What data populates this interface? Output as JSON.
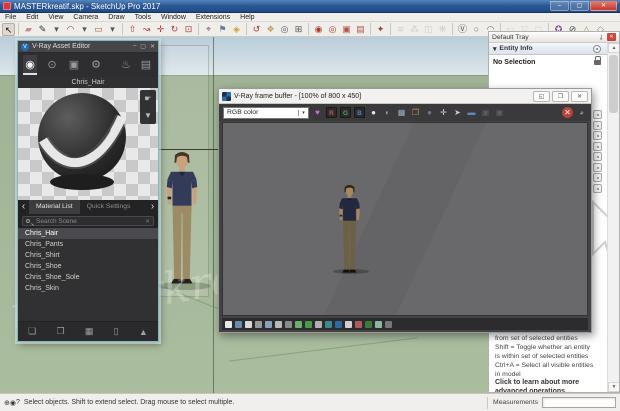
{
  "window": {
    "title": "MASTERkreatif.skp - SketchUp Pro 2017",
    "controls": [
      {
        "name": "minimize-button",
        "glyph": "–"
      },
      {
        "name": "maximize-button",
        "glyph": "▢"
      },
      {
        "name": "close-button",
        "glyph": "✕"
      }
    ]
  },
  "menu": {
    "items": [
      "File",
      "Edit",
      "View",
      "Camera",
      "Draw",
      "Tools",
      "Window",
      "Extensions",
      "Help"
    ]
  },
  "toolbar": {
    "icons": [
      {
        "n": "select-tool",
        "g": "↖",
        "c": "#111",
        "sel": true
      },
      {
        "sep": true
      },
      {
        "n": "eraser-tool",
        "g": "▰",
        "c": "#c98b90"
      },
      {
        "n": "line-tool",
        "g": "✎",
        "c": "#333"
      },
      {
        "n": "line-dropdown",
        "g": "▾",
        "c": "#555"
      },
      {
        "n": "arc-tool",
        "g": "◠",
        "c": "#8a4030"
      },
      {
        "n": "arc-dropdown",
        "g": "▾",
        "c": "#555"
      },
      {
        "n": "rectangle-tool",
        "g": "▭",
        "c": "#9a5a48"
      },
      {
        "n": "shape-dropdown",
        "g": "▾",
        "c": "#555"
      },
      {
        "sep": true
      },
      {
        "n": "push-pull-tool",
        "g": "⇧",
        "c": "#b03a2e"
      },
      {
        "n": "follow-me-tool",
        "g": "↝",
        "c": "#b03a2e"
      },
      {
        "n": "move-tool",
        "g": "✛",
        "c": "#c0392b"
      },
      {
        "n": "rotate-tool",
        "g": "↻",
        "c": "#c0392b"
      },
      {
        "n": "offset-tool",
        "g": "⊡",
        "c": "#b03a2e"
      },
      {
        "sep": true
      },
      {
        "n": "tape-measure-tool",
        "g": "⌖",
        "c": "#a04a6a"
      },
      {
        "n": "dimension-tool",
        "g": "⚑",
        "c": "#667a8a"
      },
      {
        "n": "paint-bucket-tool",
        "g": "◈",
        "c": "#c8a23a"
      },
      {
        "sep": true
      },
      {
        "n": "orbit-tool",
        "g": "↺",
        "c": "#b03a2e"
      },
      {
        "n": "pan-tool",
        "g": "❖",
        "c": "#c49a5a"
      },
      {
        "n": "zoom-tool",
        "g": "◎",
        "c": "#555"
      },
      {
        "n": "zoom-extents-tool",
        "g": "⊞",
        "c": "#555"
      },
      {
        "sep": true
      },
      {
        "n": "vray-render-button",
        "g": "◉",
        "c": "#b03a2e"
      },
      {
        "n": "vray-interactive-render-button",
        "g": "◎",
        "c": "#b03a2e"
      },
      {
        "n": "vray-viewport-render-button",
        "g": "▣",
        "c": "#b5524a"
      },
      {
        "n": "vray-batch-render-button",
        "g": "▤",
        "c": "#b5524a"
      },
      {
        "sep": true
      },
      {
        "n": "vray-asset-editor-button",
        "g": "✦",
        "c": "#b03a2e"
      },
      {
        "sep": true
      },
      {
        "n": "vray-infinite-plane-button",
        "g": "≋",
        "c": "#b9b9b9",
        "d": true
      },
      {
        "n": "vray-fur-button",
        "g": "⁂",
        "c": "#b9b9b9",
        "d": true
      },
      {
        "n": "vray-clipper-button",
        "g": "◫",
        "c": "#b9b9b9",
        "d": true
      },
      {
        "n": "vray-mesh-light-button",
        "g": "❋",
        "c": "#b9b9b9",
        "d": true
      },
      {
        "sep": true
      },
      {
        "n": "vray-logo-button",
        "g": "Ⓥ",
        "c": "#555"
      },
      {
        "n": "vray-sphere-light-button",
        "g": "○",
        "c": "#666"
      },
      {
        "n": "vray-dome-light-button",
        "g": "◠",
        "c": "#666"
      },
      {
        "sep": true
      },
      {
        "n": "vray-rect-light-button",
        "g": "▭",
        "c": "#bbb",
        "d": true
      },
      {
        "n": "vray-spot-light-button",
        "g": "▽",
        "c": "#bbb",
        "d": true
      },
      {
        "n": "vray-ies-light-button",
        "g": "◻",
        "c": "#bbb",
        "d": true
      },
      {
        "sep": true
      },
      {
        "n": "extension-a-button",
        "g": "✪",
        "c": "#7a4a9a"
      },
      {
        "n": "extension-b-button",
        "g": "⊘",
        "c": "#444"
      },
      {
        "n": "extension-c-button",
        "g": "△",
        "c": "#b08a3a"
      },
      {
        "n": "extension-d-button",
        "g": "◇",
        "c": "#888"
      }
    ]
  },
  "viewport": {
    "watermark": "masterkreatif"
  },
  "asset_editor": {
    "title": "V-Ray Asset Editor",
    "logo_glyph": "V",
    "window_controls": [
      {
        "name": "ae-minimize-button",
        "glyph": "–"
      },
      {
        "name": "ae-maximize-button",
        "glyph": "▢"
      },
      {
        "name": "ae-close-button",
        "glyph": "✕"
      }
    ],
    "nav_icons": [
      {
        "n": "materials-tab",
        "g": "◉",
        "sel": true
      },
      {
        "n": "lights-tab",
        "g": "⊙"
      },
      {
        "n": "geometry-tab",
        "g": "▣"
      },
      {
        "n": "settings-tab",
        "g": "⚙"
      }
    ],
    "right_icons": [
      {
        "n": "render-button",
        "g": "♨"
      },
      {
        "n": "frame-buffer-button",
        "g": "▤"
      }
    ],
    "material_name": "Chris_Hair",
    "preview_buttons": [
      {
        "n": "apply-to-selection-button",
        "g": "☛"
      },
      {
        "n": "save-preview-button",
        "g": "▼"
      }
    ],
    "prev_arrow": "‹",
    "next_arrow": "›",
    "tabs": [
      {
        "label": "Material List",
        "active": true
      },
      {
        "label": "Quick Settings",
        "active": false
      }
    ],
    "search_placeholder": "Search Scene",
    "clear_glyph": "✕",
    "materials": [
      "Chris_Hair",
      "Chris_Pants",
      "Chris_Shirt",
      "Chris_Shoe",
      "Chris_Shoe_Sole",
      "Chris_Skin"
    ],
    "selected_material": "Chris_Hair",
    "footer_icons": [
      {
        "n": "add-asset-button",
        "g": "❏"
      },
      {
        "n": "open-asset-button",
        "g": "❐"
      },
      {
        "n": "save-asset-button",
        "g": "▦"
      },
      {
        "n": "delete-asset-button",
        "g": "▯"
      },
      {
        "n": "up-asset-button",
        "g": "▲"
      }
    ]
  },
  "frame_buffer": {
    "title": "V-Ray frame buffer - [100% of 800 x 450]",
    "window_controls": [
      {
        "name": "vfb-dock-button",
        "glyph": "◱"
      },
      {
        "name": "vfb-restore-button",
        "glyph": "❐"
      },
      {
        "name": "vfb-close-button",
        "glyph": "✕"
      }
    ],
    "channel_dropdown": "RGB color",
    "dropdown_glyph": "▾",
    "toolbar_icons": [
      {
        "n": "save-channels-button",
        "g": "♥",
        "c": "#c96fd0"
      },
      {
        "n": "red-channel-button",
        "g": "R",
        "c": "#c05a50",
        "btn": true
      },
      {
        "n": "green-channel-button",
        "g": "G",
        "c": "#5aa05a",
        "btn": true
      },
      {
        "n": "blue-channel-button",
        "g": "B",
        "c": "#5a7ac0",
        "btn": true
      },
      {
        "n": "alpha-channel-button",
        "g": "●",
        "c": "#e8e8e8"
      },
      {
        "n": "monochrome-button",
        "g": "◐",
        "c": "#9a9a9a"
      },
      {
        "n": "save-image-button",
        "g": "▦",
        "c": "#9ab0c0"
      },
      {
        "n": "open-image-button",
        "g": "❐",
        "c": "#c89a5a"
      },
      {
        "n": "clear-image-button",
        "g": "●",
        "c": "#77757a"
      },
      {
        "n": "track-mouse-button",
        "g": "✛",
        "c": "#e0e0e0"
      },
      {
        "n": "pointer-button",
        "g": "➤",
        "c": "#cccccc"
      },
      {
        "n": "region-render-button",
        "g": "▬",
        "c": "#5a8ac0"
      },
      {
        "n": "compare-a-button",
        "g": "▣",
        "c": "#8a8a8d",
        "d": true
      },
      {
        "n": "compare-b-button",
        "g": "▣",
        "c": "#8a8a8d",
        "d": true
      },
      {
        "spacer": true
      },
      {
        "n": "stop-render-button",
        "g": "✕",
        "stop": true
      },
      {
        "n": "render-last-button",
        "g": "◕",
        "c": "#7a8aa0"
      }
    ],
    "footer_icon_colors": [
      "#e8e8e8",
      "#6a8ab0",
      "#d8d8d8",
      "#9a9a9a",
      "#8aa0b8",
      "#b8b8b8",
      "#8a8a8a",
      "#6ab06a",
      "#4a9a4a",
      "#b0b0b0",
      "#3a8a8a",
      "#2a6aa0",
      "#d0d0d0",
      "#b05a5a",
      "#3a7a3a",
      "#88b8a0",
      "#777777"
    ]
  },
  "tray": {
    "title": "Default Tray",
    "pin_glyph": "⊸",
    "close_glyph": "✕",
    "entity_info": {
      "collapse_glyph": "▾",
      "label": "Entity Info",
      "content": "No Selection"
    },
    "collapsed_panel_count": 8,
    "instructor_text": [
      "from set of selected entities",
      "Shift = Toggle whether an entity",
      "is within set of selected entities",
      "Ctrl+A = Select all visible entities",
      "in model"
    ],
    "instructor_link": [
      "Click to learn about more",
      "advanced operations..."
    ]
  },
  "status_bar": {
    "icons": [
      {
        "n": "geo-location-icon",
        "g": "⊕"
      },
      {
        "n": "credits-icon",
        "g": "◉"
      },
      {
        "n": "help-icon",
        "g": "?"
      }
    ],
    "message": "Select objects. Shift to extend select. Drag mouse to select multiple.",
    "measurements_label": "Measurements",
    "measurements_value": ""
  },
  "colors": {
    "titlebar_blue": "#2d5a96",
    "vray_blue": "#1f72b8",
    "sky": "#c4d4de",
    "ground": "#a4b79a",
    "render_bg": "#69686b",
    "figure_viewport": {
      "skin": "#c9a27d",
      "hair": "#453526",
      "shirt": "#333b58",
      "pants": "#9c8b65",
      "shoes": "#26211c"
    },
    "figure_render": {
      "skin": "#a8885f",
      "hair": "#2e2318",
      "shirt": "#23283f",
      "pants": "#6e6045",
      "shoes": "#131008"
    }
  }
}
